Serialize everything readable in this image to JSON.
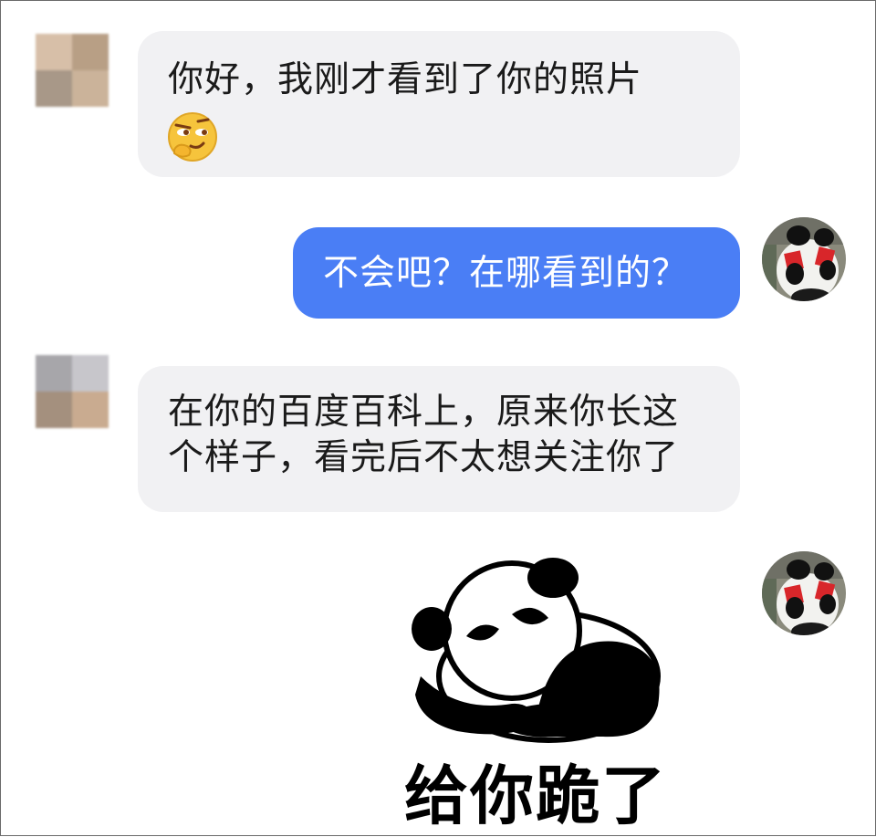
{
  "messages": [
    {
      "id": "m1",
      "side": "incoming",
      "text": "你好，我刚才看到了你的照片",
      "emoji": "smirk-thinking-emoji"
    },
    {
      "id": "m2",
      "side": "outgoing",
      "text": "不会吧？在哪看到的？"
    },
    {
      "id": "m3",
      "side": "incoming",
      "lines": [
        "在你的百度百科上，原来你长这",
        "个样子，看完后不太想关注你了"
      ]
    },
    {
      "id": "m4",
      "side": "outgoing",
      "sticker": "kneeling-panda-sticker",
      "caption": "给你跪了"
    }
  ],
  "colors": {
    "incoming_bubble": "#f1f1f3",
    "outgoing_bubble": "#4a7ef5",
    "outgoing_text": "#ffffff",
    "incoming_text": "#1a1a1a"
  },
  "icons": {
    "incoming_avatar": "blurred-mosaic-avatar",
    "outgoing_avatar": "panda-avatar"
  }
}
